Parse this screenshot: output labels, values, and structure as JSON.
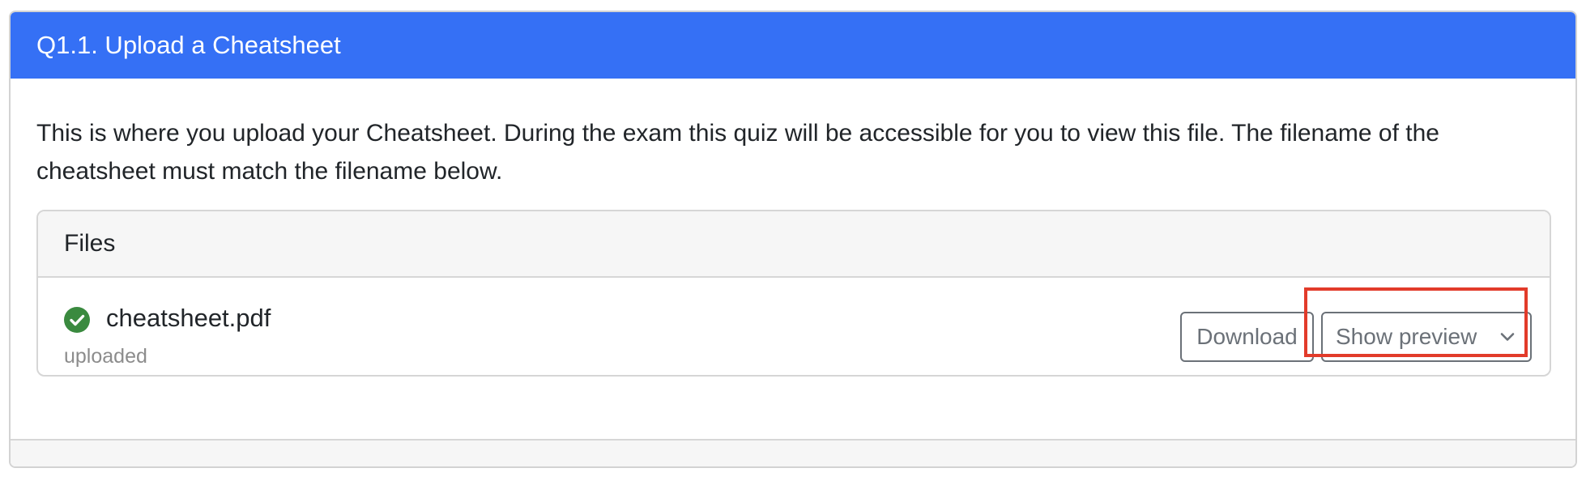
{
  "question": {
    "title": "Q1.1. Upload a Cheatsheet",
    "description": "This is where you upload your Cheatsheet. During the exam this quiz will be accessible for you to view this file. The filename of the cheatsheet must match the filename below."
  },
  "files": {
    "header": "Files",
    "items": [
      {
        "name": "cheatsheet.pdf",
        "status": "uploaded",
        "status_icon": "check-circle-icon",
        "status_color": "#3a8a3f",
        "download_label": "Download",
        "preview_label": "Show preview"
      }
    ]
  },
  "colors": {
    "header_bg": "#3570f5",
    "highlight": "#e23b2a"
  }
}
